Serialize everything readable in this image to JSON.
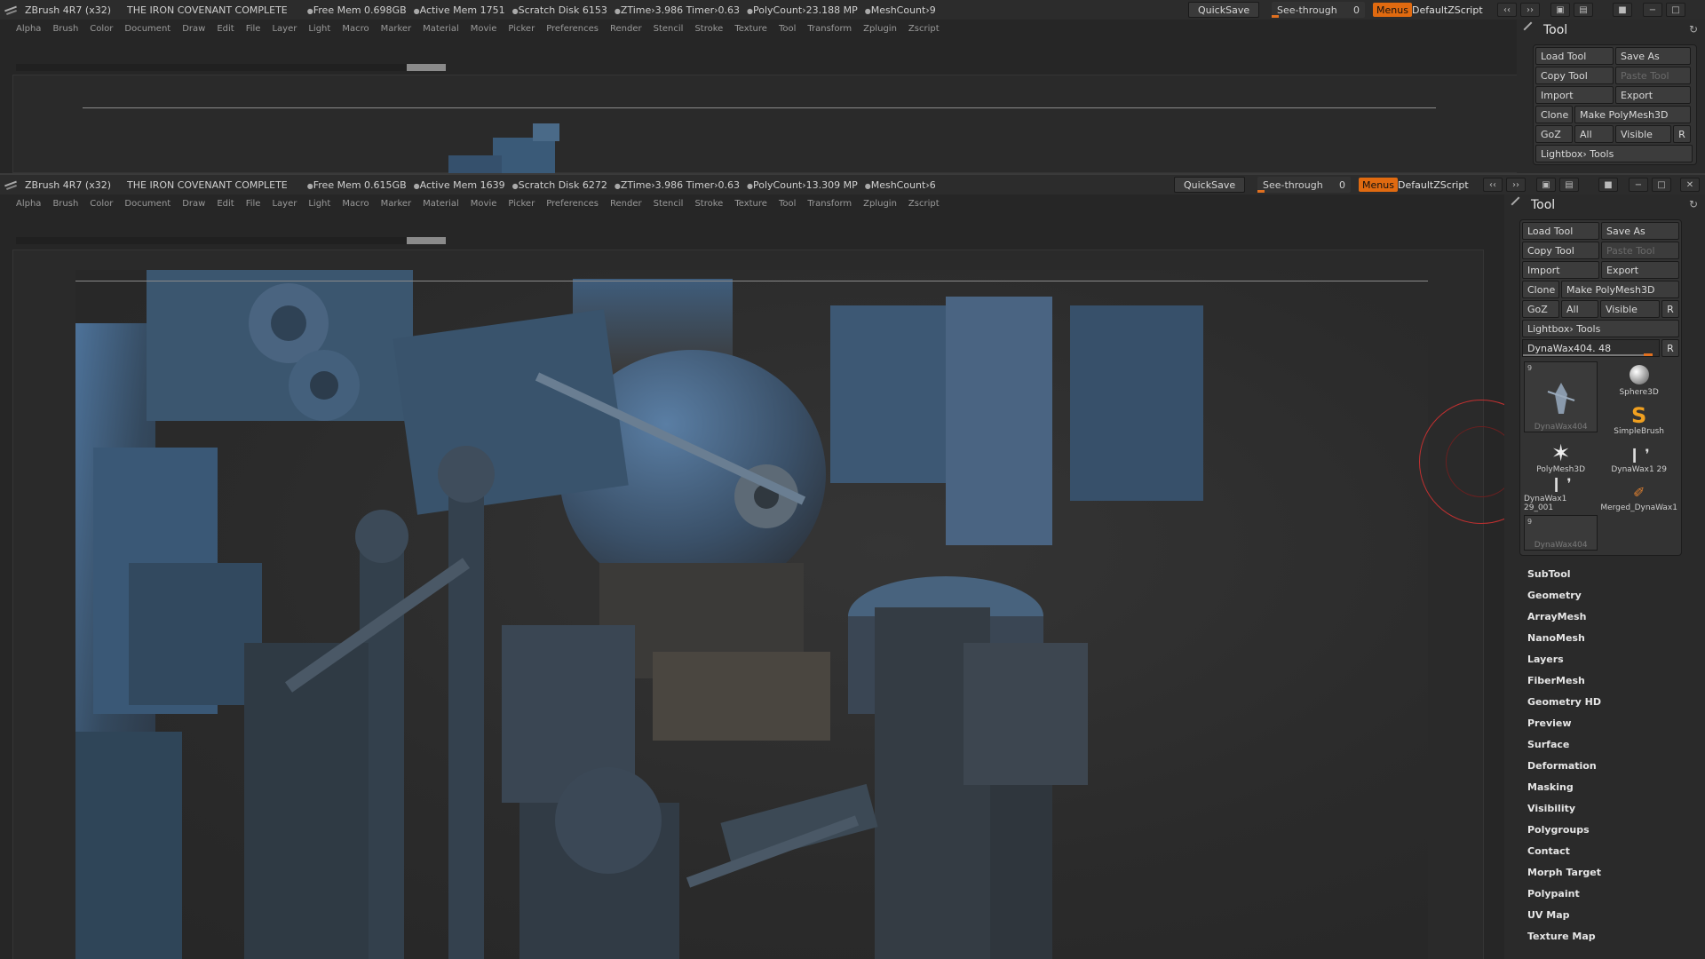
{
  "app": {
    "name": "ZBrush 4R7 (x32)",
    "document_title": "THE IRON COVENANT COMPLETE"
  },
  "back_window": {
    "stats": [
      "Free Mem 0.698GB",
      "Active Mem 1751",
      "Scratch Disk 6153",
      "ZTime›3.986 Timer›0.63",
      "PolyCount›23.188 MP",
      "MeshCount›9"
    ]
  },
  "front_window": {
    "stats": [
      "Free Mem 0.615GB",
      "Active Mem 1639",
      "Scratch Disk 6272",
      "ZTime›3.986 Timer›0.63",
      "PolyCount›13.309 MP",
      "MeshCount›6"
    ]
  },
  "titlebar": {
    "quicksave": "QuickSave",
    "seethrough_label": "See-through",
    "seethrough_value": "0",
    "menus": "Menus",
    "script": "DefaultZScript"
  },
  "menubar": [
    "Alpha",
    "Brush",
    "Color",
    "Document",
    "Draw",
    "Edit",
    "File",
    "Layer",
    "Light",
    "Macro",
    "Marker",
    "Material",
    "Movie",
    "Picker",
    "Preferences",
    "Render",
    "Stencil",
    "Stroke",
    "Texture",
    "Tool",
    "Transform",
    "Zplugin",
    "Zscript"
  ],
  "tool_panel": {
    "title": "Tool",
    "load_tool": "Load Tool",
    "save_as": "Save As",
    "copy_tool": "Copy Tool",
    "paste_tool": "Paste Tool",
    "import": "Import",
    "export": "Export",
    "clone": "Clone",
    "make_polymesh": "Make PolyMesh3D",
    "goz": "GoZ",
    "all": "All",
    "visible": "Visible",
    "r": "R",
    "lightbox_tools": "Lightbox› Tools",
    "current_tool": "DynaWax404. 48",
    "thumbs": [
      {
        "label": "DynaWax404",
        "badge": "9"
      },
      {
        "label": "Sphere3D"
      },
      {
        "label": "SimpleBrush"
      },
      {
        "label": "PolyMesh3D"
      },
      {
        "label": "DynaWax1 29"
      },
      {
        "label": "DynaWax1 29_001"
      },
      {
        "label": "Merged_DynaWax1"
      },
      {
        "label": "DynaWax404",
        "badge": "9"
      }
    ],
    "sections": [
      "SubTool",
      "Geometry",
      "ArrayMesh",
      "NanoMesh",
      "Layers",
      "FiberMesh",
      "Geometry HD",
      "Preview",
      "Surface",
      "Deformation",
      "Masking",
      "Visibility",
      "Polygroups",
      "Contact",
      "Morph Target",
      "Polypaint",
      "UV Map",
      "Texture Map"
    ]
  },
  "colors": {
    "accent": "#e06a10",
    "background": "#262626",
    "model": "#3a5a78"
  }
}
